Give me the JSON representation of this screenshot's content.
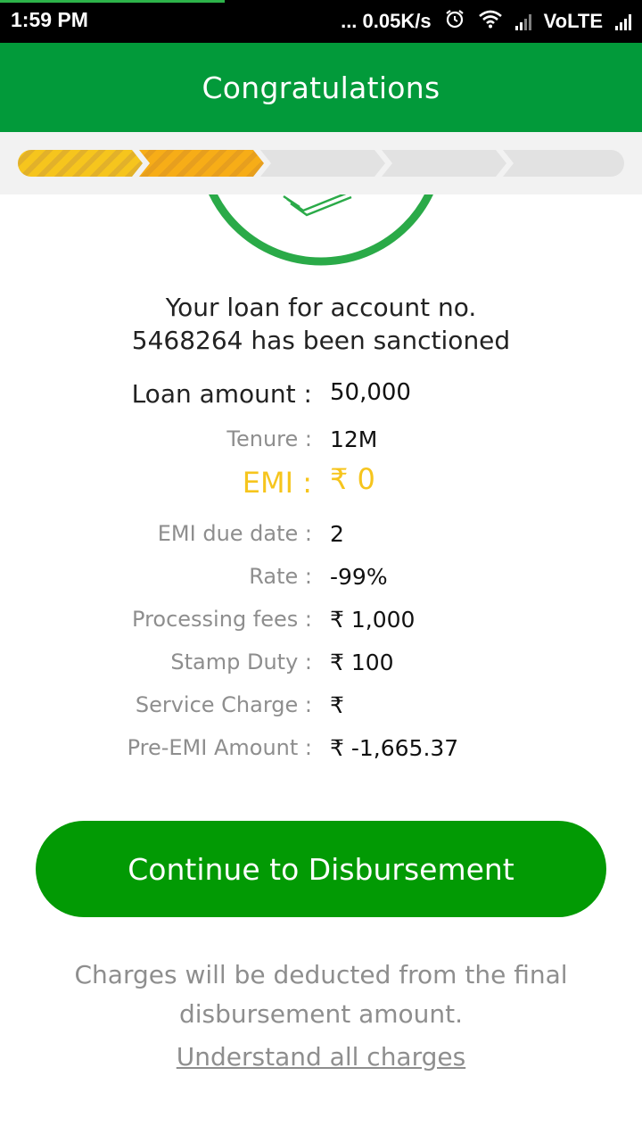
{
  "status_bar": {
    "time": "1:59 PM",
    "network_speed": "... 0.05K/s",
    "network_type": "VoLTE",
    "icons": [
      "alarm-icon",
      "wifi-icon",
      "signal-icon",
      "signal-icon"
    ]
  },
  "header": {
    "title": "Congratulations",
    "color": "#029a3a"
  },
  "progress": {
    "total_steps": 5,
    "completed_steps": 2,
    "colors": [
      "#f6c51d",
      "#f7ad17",
      "#e2e2e2",
      "#e2e2e2",
      "#e2e2e2"
    ]
  },
  "success_icon": "checkmark-circle-icon",
  "message": {
    "line1": "Your loan for account no.",
    "line2": "5468264 has been sanctioned"
  },
  "details": [
    {
      "label": "Loan amount :",
      "value": "50,000"
    },
    {
      "label": "Tenure :",
      "value": "12M"
    },
    {
      "label": "EMI :",
      "value": "₹ 0"
    },
    {
      "label": "EMI due date :",
      "value": "2"
    },
    {
      "label": "Rate :",
      "value": "-99%"
    },
    {
      "label": "Processing fees :",
      "value": "₹ 1,000"
    },
    {
      "label": "Stamp Duty :",
      "value": "₹ 100"
    },
    {
      "label": "Service Charge :",
      "value": "₹"
    },
    {
      "label": "Pre-EMI Amount :",
      "value": "₹ -1,665.37"
    }
  ],
  "cta": {
    "label": "Continue to Disbursement",
    "color": "#029a04"
  },
  "note": {
    "line1": "Charges will be deducted from the final",
    "line2": "disbursement amount."
  },
  "link": {
    "label": "Understand all charges"
  },
  "accent_color": "#f6c51d"
}
